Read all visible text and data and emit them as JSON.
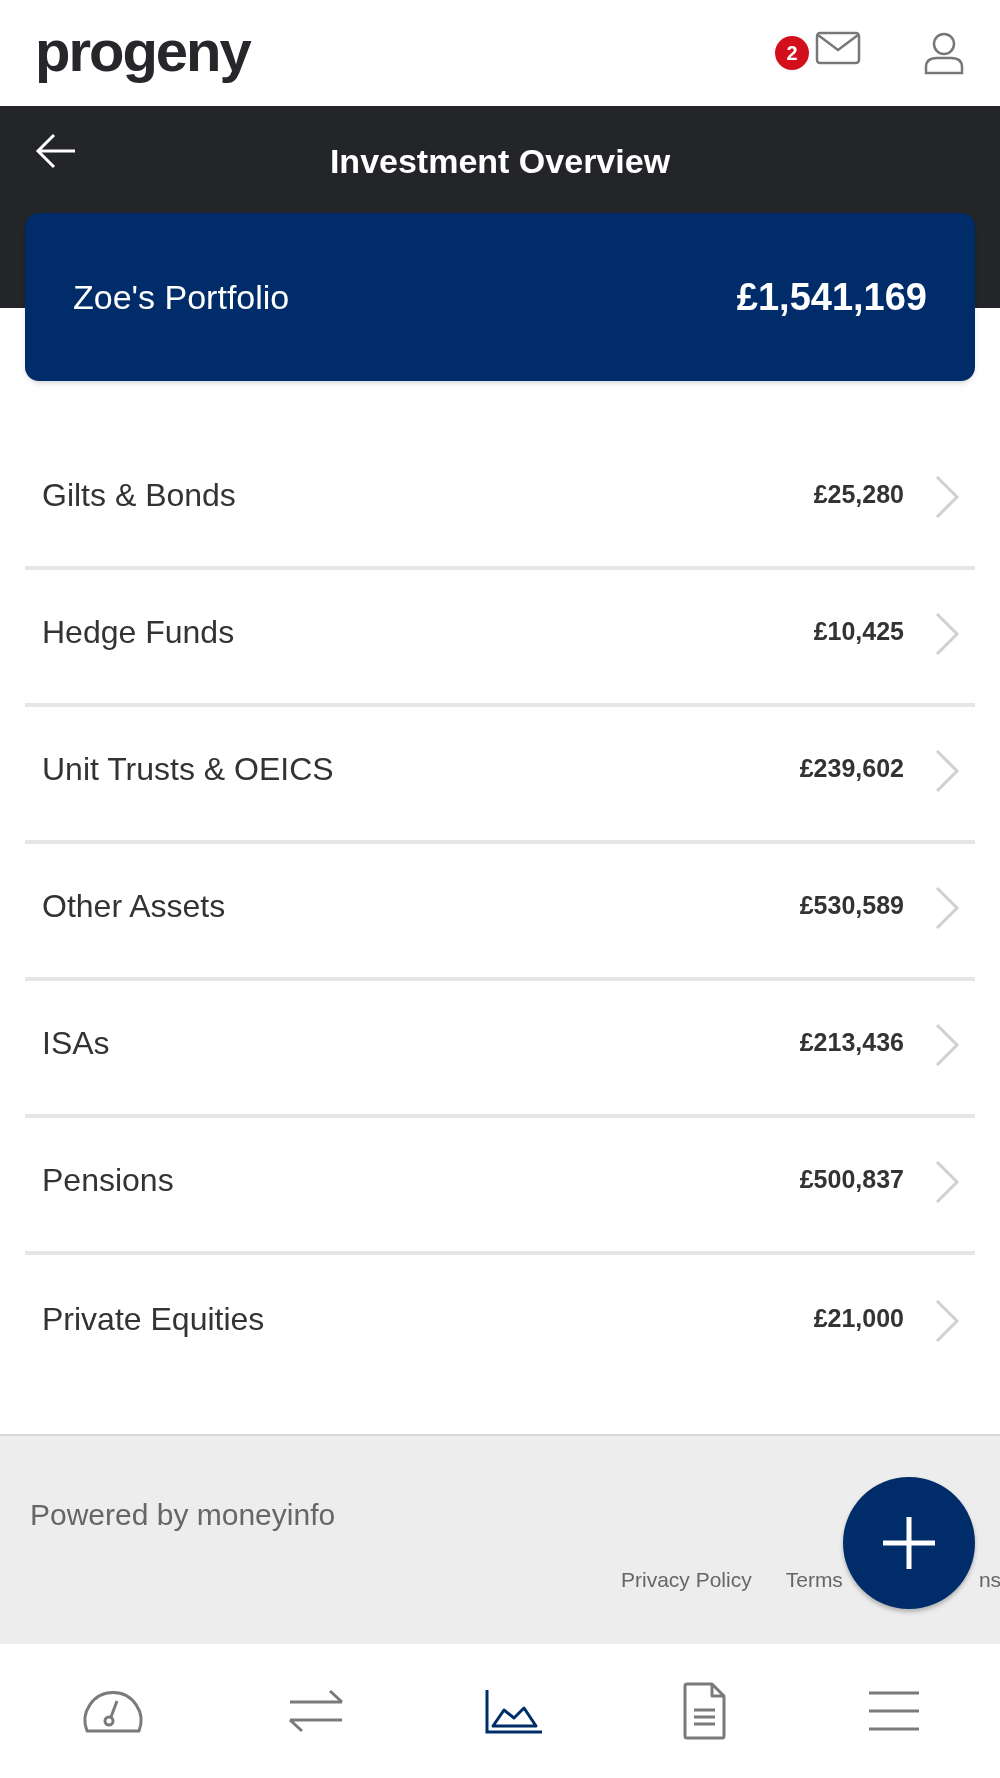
{
  "header": {
    "logo": "progeny",
    "unread_count": "2"
  },
  "title_bar": {
    "title": "Investment Overview"
  },
  "portfolio": {
    "name": "Zoe's Portfolio",
    "total": "£1,541,169"
  },
  "categories": [
    {
      "label": "Gilts & Bonds",
      "amount": "£25,280"
    },
    {
      "label": "Hedge Funds",
      "amount": "£10,425"
    },
    {
      "label": "Unit Trusts & OEICS",
      "amount": "£239,602"
    },
    {
      "label": "Other Assets",
      "amount": "£530,589"
    },
    {
      "label": "ISAs",
      "amount": "£213,436"
    },
    {
      "label": "Pensions",
      "amount": "£500,837"
    },
    {
      "label": "Private Equities",
      "amount": "£21,000"
    }
  ],
  "footer": {
    "powered_by": "Powered by moneyinfo",
    "links": [
      "Privacy Policy",
      "Terms",
      "ns"
    ]
  },
  "bottom_nav": [
    {
      "kind": "dashboard",
      "selected": false
    },
    {
      "kind": "transfers",
      "selected": false
    },
    {
      "kind": "investments",
      "selected": true
    },
    {
      "kind": "documents",
      "selected": false
    },
    {
      "kind": "menu",
      "selected": false
    }
  ]
}
